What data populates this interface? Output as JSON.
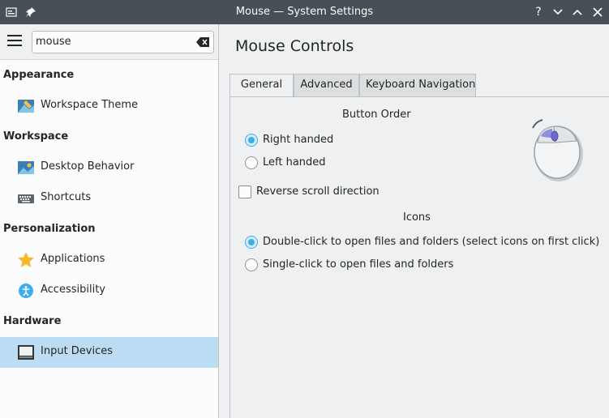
{
  "window": {
    "title": "Mouse — System Settings",
    "controls": [
      "?",
      "⌄",
      "⌃",
      "✕"
    ]
  },
  "sidebar": {
    "search": {
      "value": "mouse",
      "placeholder": ""
    },
    "categories": [
      {
        "label": "Appearance"
      },
      {
        "label": "Workspace"
      },
      {
        "label": "Personalization"
      },
      {
        "label": "Hardware"
      }
    ],
    "items": [
      {
        "label": "Workspace Theme",
        "icon": "workspace-theme-icon"
      },
      {
        "label": "Desktop Behavior",
        "icon": "desktop-behavior-icon"
      },
      {
        "label": "Shortcuts",
        "icon": "keyboard-icon"
      },
      {
        "label": "Applications",
        "icon": "star-icon"
      },
      {
        "label": "Accessibility",
        "icon": "accessibility-icon"
      },
      {
        "label": "Input Devices",
        "icon": "input-devices-icon",
        "active": true
      }
    ]
  },
  "main": {
    "title": "Mouse Controls",
    "tabs": [
      {
        "label": "General",
        "active": true
      },
      {
        "label": "Advanced"
      },
      {
        "label": "Keyboard Navigation"
      }
    ],
    "button_order": {
      "heading": "Button Order",
      "right_handed": {
        "label": "Right handed",
        "checked": true
      },
      "left_handed": {
        "label": "Left handed",
        "checked": false
      }
    },
    "reverse_scroll": {
      "label": "Reverse scroll direction",
      "checked": false
    },
    "icons": {
      "heading": "Icons",
      "double_click": {
        "label": "Double-click to open files and folders (select icons on first click)",
        "checked": true
      },
      "single_click": {
        "label": "Single-click to open files and folders",
        "checked": false
      }
    }
  },
  "colors": {
    "accent": "#3daee9",
    "selection": "#bcdcf3",
    "titlebar": "#475057"
  }
}
